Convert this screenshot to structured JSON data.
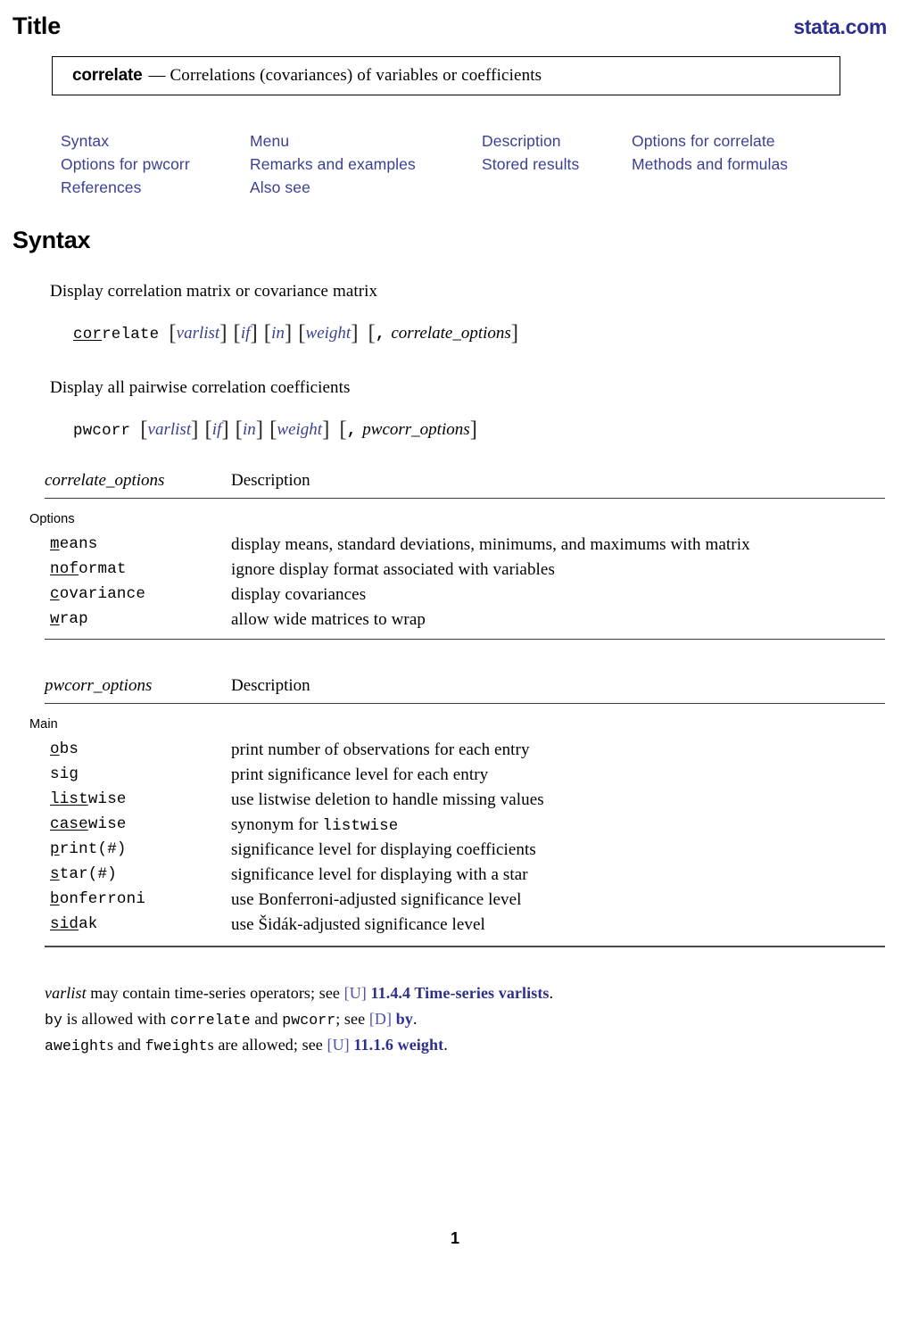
{
  "header": {
    "title": "Title",
    "site": "stata.com"
  },
  "title_box": {
    "command": "correlate",
    "dash": "—",
    "description": "Correlations (covariances) of variables or coefficients"
  },
  "nav_links": [
    "Syntax",
    "Menu",
    "Description",
    "Options for correlate",
    "Options for pwcorr",
    "Remarks and examples",
    "Stored results",
    "Methods and formulas",
    "References",
    "Also see"
  ],
  "syntax": {
    "heading": "Syntax",
    "blocks": [
      {
        "label": "Display correlation matrix or covariance matrix",
        "command_abbrev": "cor",
        "command_rest": "relate",
        "args": [
          "varlist",
          "if",
          "in",
          "weight"
        ],
        "options_arg": "correlate_options",
        "comma": ","
      },
      {
        "label": "Display all pairwise correlation coefficients",
        "command_abbrev": "",
        "command_rest": "pwcorr",
        "args": [
          "varlist",
          "if",
          "in",
          "weight"
        ],
        "options_arg": "pwcorr_options",
        "comma": ","
      }
    ]
  },
  "tables": [
    {
      "col_options": "correlate_options",
      "col_description": "Description",
      "subhead": "Options",
      "rows": [
        {
          "abbrev": "m",
          "rest": "eans",
          "description": "display means, standard deviations, minimums, and maximums with matrix"
        },
        {
          "abbrev": "nof",
          "rest": "ormat",
          "description": "ignore display format associated with variables"
        },
        {
          "abbrev": "c",
          "rest": "ovariance",
          "description": "display covariances"
        },
        {
          "abbrev": "w",
          "rest": "rap",
          "description": "allow wide matrices to wrap"
        }
      ]
    },
    {
      "col_options": "pwcorr_options",
      "col_description": "Description",
      "subhead": "Main",
      "rows": [
        {
          "abbrev": "o",
          "rest": "bs",
          "description": "print number of observations for each entry"
        },
        {
          "abbrev": "",
          "rest": "sig",
          "description": "print significance level for each entry"
        },
        {
          "abbrev": "list",
          "rest": "wise",
          "description": "use listwise deletion to handle missing values"
        },
        {
          "abbrev": "case",
          "rest": "wise",
          "description": "synonym for ",
          "description_mono": "listwise"
        },
        {
          "abbrev": "p",
          "rest": "rint(#)",
          "description": "significance level for displaying coefficients"
        },
        {
          "abbrev": "s",
          "rest": "tar(#)",
          "description": "significance level for displaying with a star"
        },
        {
          "abbrev": "b",
          "rest": "onferroni",
          "description": "use Bonferroni-adjusted significance level"
        },
        {
          "abbrev": "sid",
          "rest": "ak",
          "description": "use Šidák-adjusted significance level"
        }
      ]
    }
  ],
  "footnotes": [
    {
      "parts": [
        {
          "text": "varlist",
          "style": "italic"
        },
        {
          "text": " may contain time-series operators; see ",
          "style": "plain"
        },
        {
          "text": "[U]",
          "style": "bracket"
        },
        {
          "text": " ",
          "style": "plain"
        },
        {
          "text": "11.4.4 Time-series varlists",
          "style": "ref"
        },
        {
          "text": ".",
          "style": "plain"
        }
      ]
    },
    {
      "parts": [
        {
          "text": "by",
          "style": "mono"
        },
        {
          "text": " is allowed with ",
          "style": "plain"
        },
        {
          "text": "correlate",
          "style": "mono"
        },
        {
          "text": " and ",
          "style": "plain"
        },
        {
          "text": "pwcorr",
          "style": "mono"
        },
        {
          "text": "; see ",
          "style": "plain"
        },
        {
          "text": "[D]",
          "style": "bracket"
        },
        {
          "text": " ",
          "style": "plain"
        },
        {
          "text": "by",
          "style": "ref"
        },
        {
          "text": ".",
          "style": "plain"
        }
      ]
    },
    {
      "parts": [
        {
          "text": "aweight",
          "style": "mono"
        },
        {
          "text": "s and ",
          "style": "plain"
        },
        {
          "text": "fweight",
          "style": "mono"
        },
        {
          "text": "s are allowed; see ",
          "style": "plain"
        },
        {
          "text": "[U]",
          "style": "bracket"
        },
        {
          "text": " ",
          "style": "plain"
        },
        {
          "text": "11.1.6 weight",
          "style": "ref"
        },
        {
          "text": ".",
          "style": "plain"
        }
      ]
    }
  ],
  "page_number": "1",
  "colors": {
    "link_blue": "#3b3f94",
    "brand_navy": "#2d2f8f",
    "bracket_blue": "#4e52a8",
    "rule_gray": "#3a3a3a"
  }
}
